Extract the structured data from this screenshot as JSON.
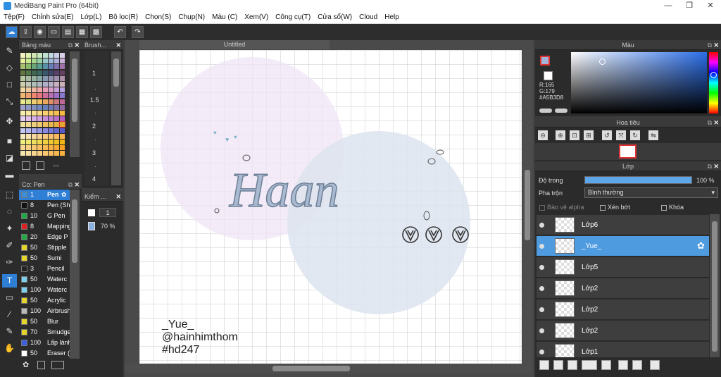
{
  "app": {
    "title": "MediBang Paint Pro (64bit)"
  },
  "menu": [
    "Tệp(F)",
    "Chỉnh sửa(E)",
    "Lớp(L)",
    "Bộ lọc(R)",
    "Chọn(S)",
    "Chụp(N)",
    "Màu (C)",
    "Xem(V)",
    "Công cụ(T)",
    "Cửa sổ(W)",
    "Cloud",
    "Help"
  ],
  "window_controls": {
    "minimize": "—",
    "maximize": "❐",
    "close": "✕"
  },
  "panels": {
    "palette": {
      "title": "Bảng màu",
      "footer_dash": "---"
    },
    "brush_size": {
      "title": "Brush...",
      "sizes": [
        "1",
        "1.5",
        "2",
        "3",
        "4"
      ]
    },
    "brush": {
      "title": "Cọ: Pen",
      "items": [
        {
          "size": "1",
          "name": "Pen",
          "color": "#3a8fd8",
          "selected": true
        },
        {
          "size": "8",
          "name": "Pen (Sh",
          "color": "#111111"
        },
        {
          "size": "10",
          "name": "G Pen",
          "color": "#22aa44"
        },
        {
          "size": "8",
          "name": "Mapping",
          "color": "#dd2222"
        },
        {
          "size": "20",
          "name": "Edge P",
          "color": "#22aa44"
        },
        {
          "size": "50",
          "name": "Stipple",
          "color": "#e6d62a"
        },
        {
          "size": "50",
          "name": "Sumi",
          "color": "#e6d62a"
        },
        {
          "size": "3",
          "name": "Pencil",
          "color": "#222222"
        },
        {
          "size": "50",
          "name": "Waterc",
          "color": "#7fd0f0"
        },
        {
          "size": "100",
          "name": "Waterc",
          "color": "#7fd0f0"
        },
        {
          "size": "50",
          "name": "Acrylic",
          "color": "#e6d62a"
        },
        {
          "size": "100",
          "name": "Airbrush",
          "color": "#bbbbbb"
        },
        {
          "size": "50",
          "name": "Blur",
          "color": "#e6d62a"
        },
        {
          "size": "70",
          "name": "Smudge",
          "color": "#e6d62a"
        },
        {
          "size": "100",
          "name": "Lấp lánh",
          "color": "#3a5fe0"
        },
        {
          "size": "50",
          "name": "Eraser (",
          "color": "#ffffff"
        }
      ]
    },
    "check": {
      "title": "Kiểm ...",
      "size": "1",
      "opacity": "70 %"
    },
    "color": {
      "title": "Màu",
      "r": "R:165",
      "g": "G:179",
      "hex": "#A5B3D8"
    },
    "navigator": {
      "title": "Hoa tiêu"
    },
    "layer": {
      "title": "Lớp",
      "opacity_label": "Độ trong",
      "opacity_value": "100 %",
      "opacity_fraction": 1.0,
      "blend_label": "Pha trộn",
      "blend_value": "Bình thường",
      "protect_alpha": "Bảo vệ alpha",
      "clipping": "Xén bớt",
      "lock": "Khóa",
      "layers": [
        {
          "name": "Lớp6"
        },
        {
          "name": "_Yue_",
          "selected": true
        },
        {
          "name": "Lớp5"
        },
        {
          "name": "Lớp2"
        },
        {
          "name": "Lớp2"
        },
        {
          "name": "Lớp2"
        },
        {
          "name": "Lớp1"
        }
      ]
    }
  },
  "canvas": {
    "tab": "Untitled",
    "title_text": "Haan",
    "credit1": "_Yue_",
    "credit2": "@hainhimthom",
    "credit3": "#hd247"
  },
  "colors": {
    "accent": "#2f7fd6",
    "current_color": "#A5B3D8"
  }
}
